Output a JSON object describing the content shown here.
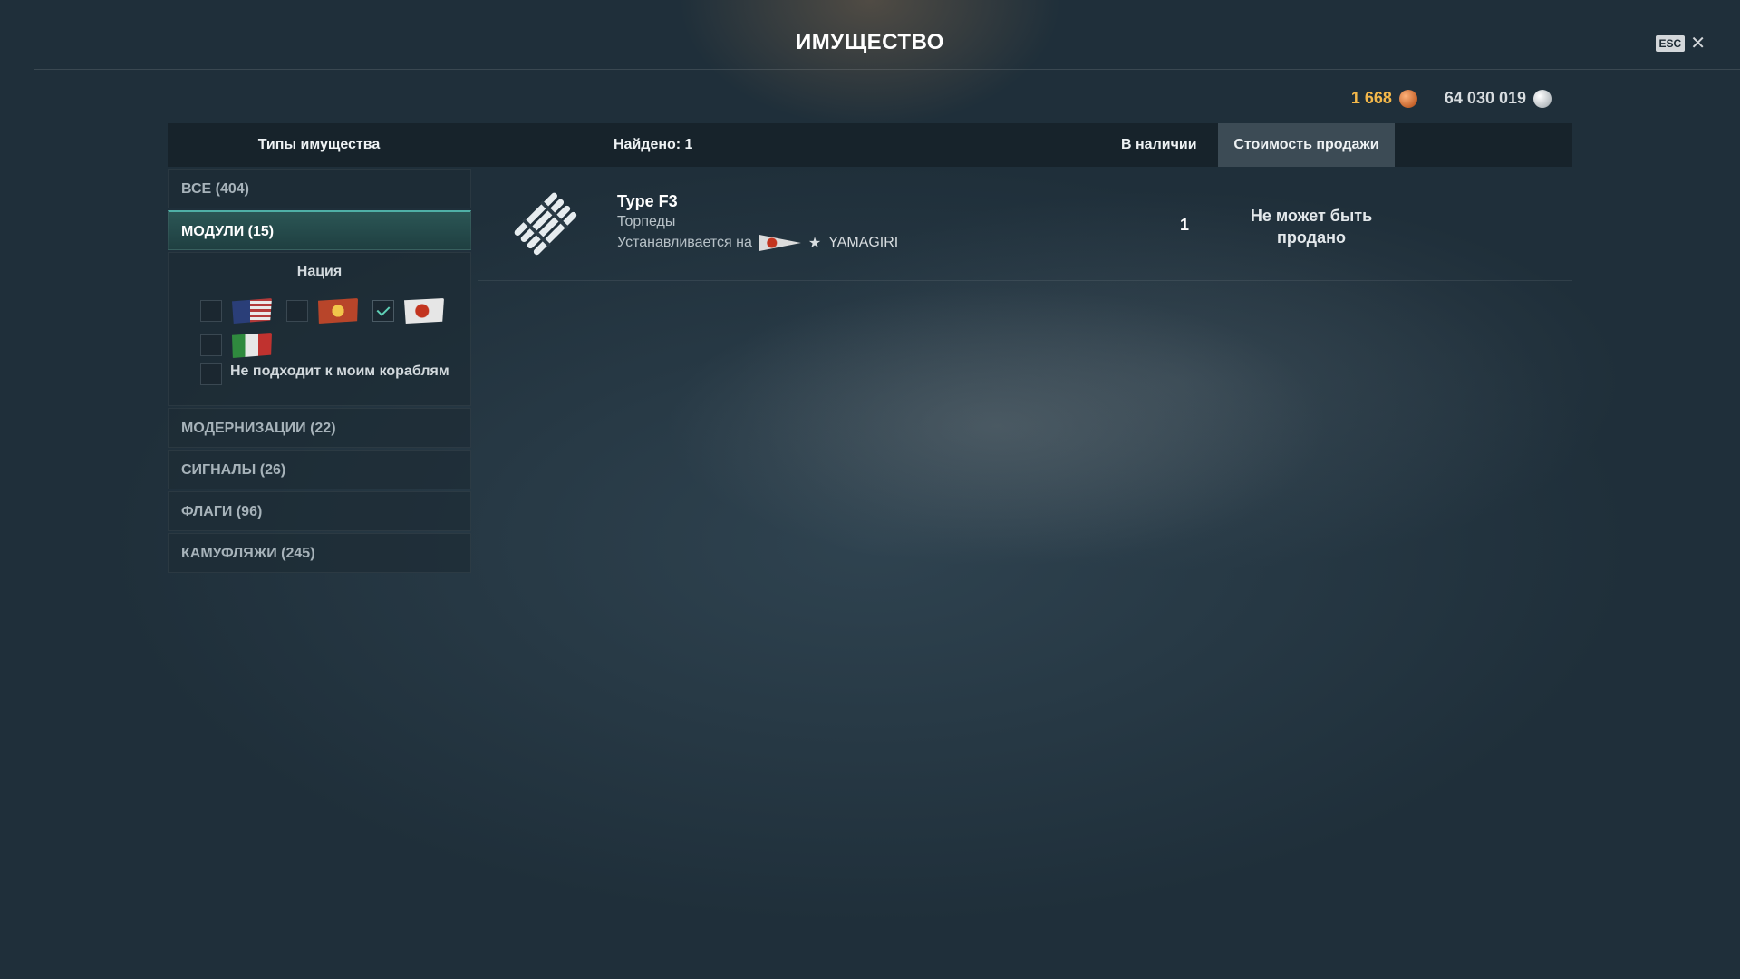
{
  "header": {
    "title": "ИМУЩЕСТВО",
    "esc_label": "ESC",
    "close_glyph": "✕"
  },
  "currency": {
    "doubloons": "1 668",
    "credits": "64 030 019",
    "doubloon_icon": "doubloon-icon",
    "credit_icon": "credit-icon"
  },
  "columns": {
    "types": "Типы имущества",
    "found": "Найдено: 1",
    "in_stock": "В наличии",
    "sale_price": "Стоимость продажи"
  },
  "sidebar": {
    "categories": [
      {
        "label": "ВСЕ (404)",
        "active": false
      },
      {
        "label": "МОДУЛИ (15)",
        "active": true
      },
      {
        "label": "МОДЕРНИЗАЦИИ (22)",
        "active": false
      },
      {
        "label": "СИГНАЛЫ (26)",
        "active": false
      },
      {
        "label": "ФЛАГИ (96)",
        "active": false
      },
      {
        "label": "КАМУФЛЯЖИ (245)",
        "active": false
      }
    ],
    "filter": {
      "title": "Нация",
      "nations": [
        {
          "name": "usa-flag",
          "checked": false
        },
        {
          "name": "france-flag",
          "checked": false
        },
        {
          "name": "japan-flag",
          "checked": true
        },
        {
          "name": "italy-flag",
          "checked": false
        }
      ],
      "not_fitting_label": "Не подходит к моим кораблям",
      "not_fitting_checked": false
    }
  },
  "results": [
    {
      "name": "Type F3",
      "type": "Торпеды",
      "installed_label": "Устанавливается на",
      "ship_star": "★",
      "ship_name": "YAMAGIRI",
      "stock": "1",
      "price_line1": "Не может быть",
      "price_line2": "продано"
    }
  ],
  "colors": {
    "accent": "#4fb0a7",
    "doubloon": "#f4b84a",
    "active_category": "#2b5655"
  }
}
